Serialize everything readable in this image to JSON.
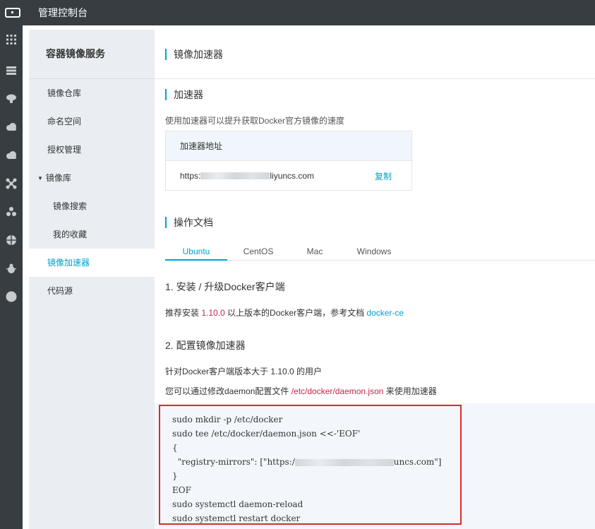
{
  "topbar": {
    "title": "管理控制台"
  },
  "rail": {
    "icons": [
      "grid-icon",
      "list-icon",
      "brain-icon",
      "cloud-icon",
      "cloud-upload-icon",
      "nodes-icon",
      "cluster-icon",
      "globe-icon",
      "bug-icon",
      "circle-icon"
    ]
  },
  "sidebar": {
    "title": "容器镜像服务",
    "items": [
      {
        "label": "镜像仓库"
      },
      {
        "label": "命名空间"
      },
      {
        "label": "授权管理"
      },
      {
        "label": "镜像库"
      },
      {
        "label": "镜像搜索"
      },
      {
        "label": "我的收藏"
      },
      {
        "label": "镜像加速器"
      },
      {
        "label": "代码源"
      }
    ]
  },
  "main": {
    "page_title": "镜像加速器",
    "accelerator": {
      "heading": "加速器",
      "description": "使用加速器可以提升获取Docker官方镜像的速度",
      "table_header": "加速器地址",
      "url_prefix": "https:",
      "url_suffix": "liyuncs.com",
      "copy_label": "复制"
    },
    "docs": {
      "heading": "操作文档",
      "tabs": [
        "Ubuntu",
        "CentOS",
        "Mac",
        "Windows"
      ],
      "active_tab": "Ubuntu",
      "step1_title": "1. 安装 / 升级Docker客户端",
      "step1_text_a": "推荐安装 ",
      "step1_version": "1.10.0",
      "step1_text_b": " 以上版本的Docker客户端，参考文档 ",
      "step1_link": "docker-ce",
      "step2_title": "2. 配置镜像加速器",
      "step2_line1": "针对Docker客户端版本大于 1.10.0 的用户",
      "step2_line2_a": "您可以通过修改daemon配置文件 ",
      "step2_path": "/etc/docker/daemon.json",
      "step2_line2_b": " 来使用加速器"
    },
    "code": {
      "line1": "sudo mkdir -p /etc/docker",
      "line2": "sudo tee /etc/docker/daemon.json <<-'EOF'",
      "line3": "{",
      "line4_a": "  \"registry-mirrors\": [\"https:/",
      "line4_b": "uncs.com\"]",
      "line5": "}",
      "line6": "EOF",
      "line7": "sudo systemctl daemon-reload",
      "line8": "sudo systemctl restart docker"
    }
  }
}
